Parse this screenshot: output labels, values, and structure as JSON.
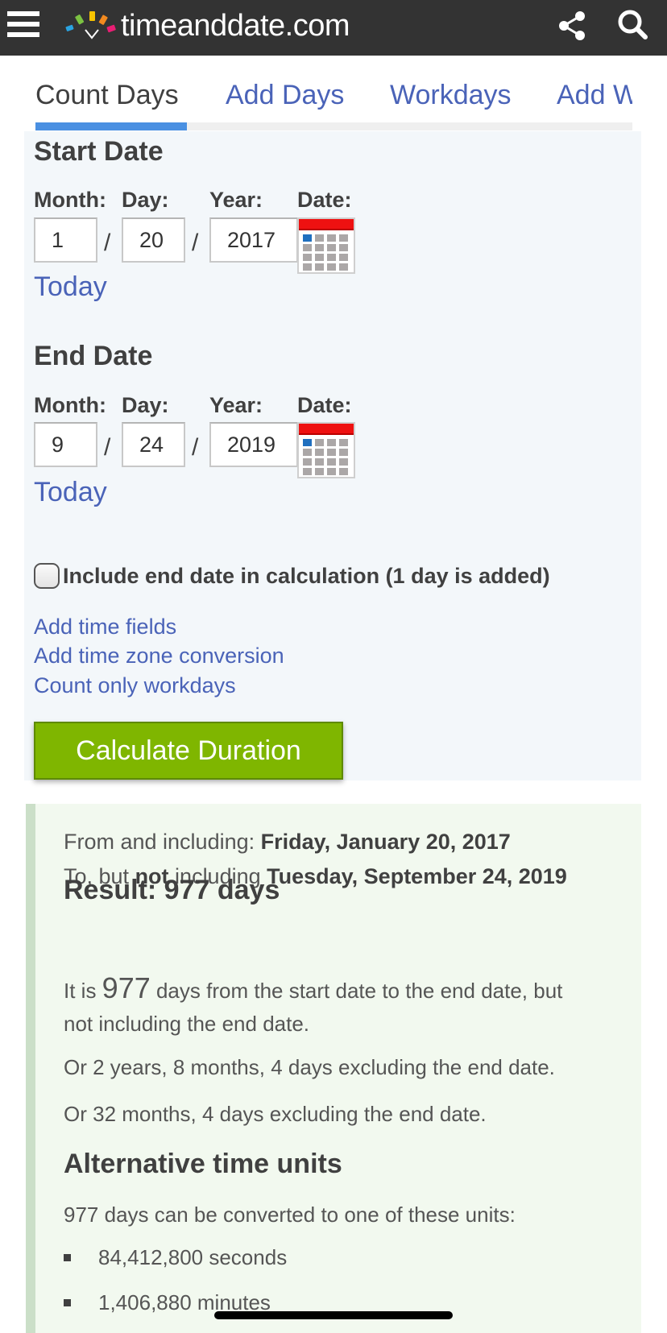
{
  "header": {
    "site_name": "timeanddate.com",
    "icons": [
      "hamburger-menu-icon",
      "logo-clock-icon",
      "share-icon",
      "search-icon"
    ]
  },
  "tabs": [
    {
      "label": "Count Days",
      "active": true
    },
    {
      "label": "Add Days",
      "active": false
    },
    {
      "label": "Workdays",
      "active": false
    },
    {
      "label": "Add Workdays",
      "active": false
    }
  ],
  "form": {
    "start": {
      "title": "Start Date",
      "month_label": "Month:",
      "day_label": "Day:",
      "year_label": "Year:",
      "date_label": "Date:",
      "month": "1",
      "day": "20",
      "year": "2017",
      "today_link": "Today"
    },
    "end": {
      "title": "End Date",
      "month_label": "Month:",
      "day_label": "Day:",
      "year_label": "Year:",
      "date_label": "Date:",
      "month": "9",
      "day": "24",
      "year": "2019",
      "today_link": "Today"
    },
    "separator": "/",
    "include_end_label": "Include end date in calculation (1 day is added)",
    "include_end_checked": false,
    "links": [
      "Add time fields",
      "Add time zone conversion",
      "Count only workdays"
    ],
    "calculate_button": "Calculate Duration"
  },
  "result": {
    "from_prefix": "From and including: ",
    "from_date": "Friday, January 20, 2017",
    "to_prefix_1": "To, but ",
    "to_not": "not",
    "to_prefix_2": " including ",
    "to_date": "Tuesday, September 24, 2019",
    "heading": "Result: 977 days",
    "para1_a": "It is ",
    "para1_num": "977",
    "para1_b": " days from the start date to the end date, but",
    "para1_c": "not including the end date.",
    "para2": "Or 2 years, 8 months, 4 days excluding the end date.",
    "para3": "Or 32 months, 4 days excluding the end date.",
    "alt_heading": "Alternative time units",
    "alt_intro": "977 days can be converted to one of these units:",
    "units": [
      "84,412,800 seconds",
      "1,406,880 minutes"
    ]
  },
  "colors": {
    "header_bg": "#333333",
    "link": "#4a63b8",
    "tab_indicator": "#4a90e2",
    "button_green": "#7fb600",
    "result_bg": "#f2f9ef",
    "form_bg": "#f3f7fa"
  }
}
